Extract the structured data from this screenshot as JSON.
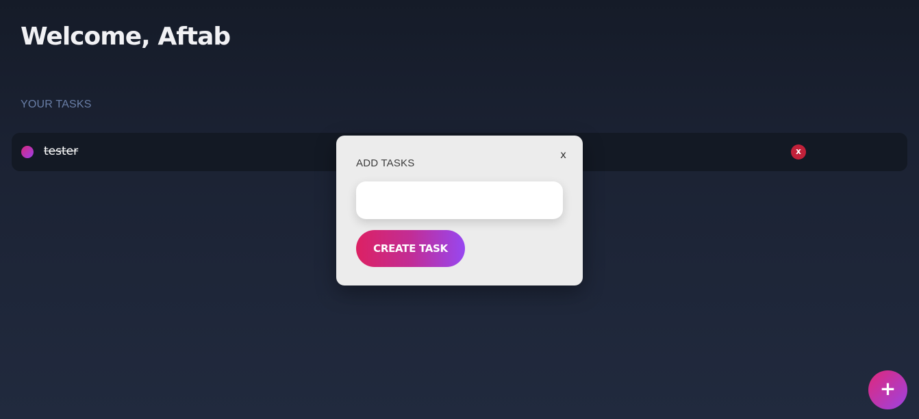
{
  "header": {
    "welcome": "Welcome, Aftab"
  },
  "tasks_section": {
    "title": "YOUR TASKS",
    "tasks": [
      {
        "text": "tester",
        "completed": true,
        "delete_label": "x"
      }
    ]
  },
  "modal": {
    "title": "ADD TASKS",
    "close_label": "x",
    "input_value": "",
    "input_placeholder": "",
    "submit_label": "CREATE TASK"
  },
  "fab": {
    "label": "+",
    "icon": "plus-icon"
  },
  "colors": {
    "accent_start": "#dc2163",
    "accent_end": "#9747f1",
    "delete_red": "#c2213a",
    "modal_bg": "#ececec",
    "row_bg": "#131924"
  }
}
